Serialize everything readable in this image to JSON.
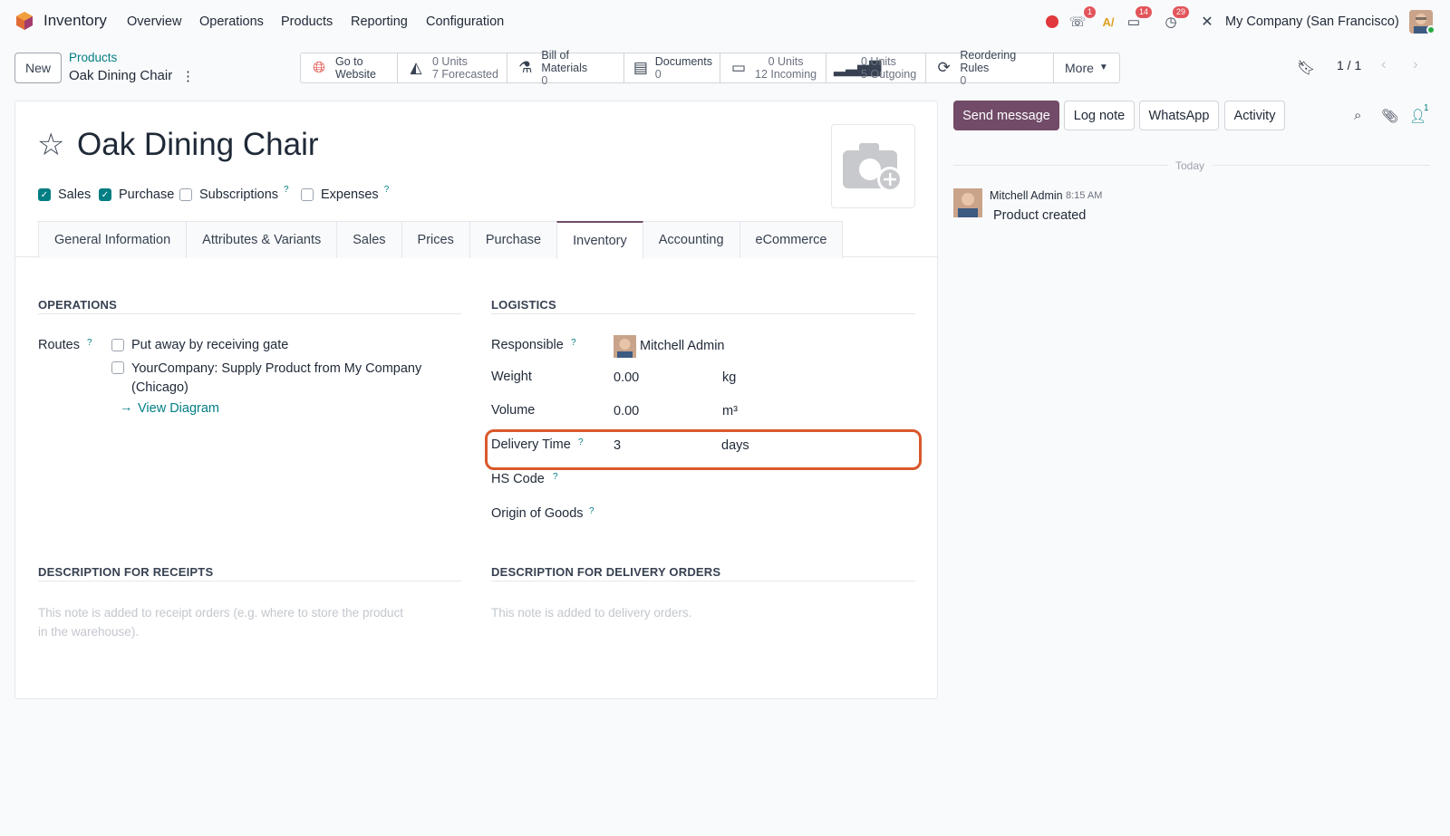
{
  "app": {
    "name": "Inventory"
  },
  "menu": [
    "Overview",
    "Operations",
    "Products",
    "Reporting",
    "Configuration"
  ],
  "systray": {
    "phone_badge": "1",
    "messages_badge": "14",
    "activity_badge": "29",
    "company": "My Company (San Francisco)"
  },
  "control": {
    "new_label": "New",
    "breadcrumb_parent": "Products",
    "breadcrumb_current": "Oak Dining Chair",
    "pager": "1 / 1"
  },
  "smart_buttons": {
    "website": {
      "line1": "Go to",
      "line2": "Website"
    },
    "forecast": {
      "line1": "0 Units",
      "line2": "7 Forecasted"
    },
    "bom": {
      "line1": "Bill of Materials",
      "line2": "0"
    },
    "documents": {
      "line1": "Documents",
      "line2": "0"
    },
    "incoming": {
      "line1": "0 Units",
      "line2": "12 Incoming"
    },
    "outgoing": {
      "line1": "0 Units",
      "line2": "5 Outgoing"
    },
    "reorder": {
      "line1": "Reordering Rules",
      "line2": "0"
    },
    "more": "More"
  },
  "product": {
    "name": "Oak Dining Chair",
    "flags": {
      "sales": "Sales",
      "purchase": "Purchase",
      "subscriptions": "Subscriptions",
      "expenses": "Expenses"
    }
  },
  "tabs": [
    "General Information",
    "Attributes & Variants",
    "Sales",
    "Prices",
    "Purchase",
    "Inventory",
    "Accounting",
    "eCommerce"
  ],
  "operations": {
    "title": "OPERATIONS",
    "routes_label": "Routes",
    "route1": "Put away by receiving gate",
    "route2_line1": "YourCompany: Supply Product from My Company",
    "route2_line2": "(Chicago)",
    "view_diagram": "View Diagram"
  },
  "logistics": {
    "title": "LOGISTICS",
    "responsible_label": "Responsible",
    "responsible": "Mitchell Admin",
    "weight_label": "Weight",
    "weight": "0.00",
    "weight_unit": "kg",
    "volume_label": "Volume",
    "volume": "0.00",
    "volume_unit": "m³",
    "delivery_label": "Delivery Time",
    "delivery": "3",
    "delivery_unit": "days",
    "hs_label": "HS Code",
    "origin_label": "Origin of Goods"
  },
  "descriptions": {
    "receipts_title": "DESCRIPTION FOR RECEIPTS",
    "receipts_ph1": "This note is added to receipt orders (e.g. where to store the product",
    "receipts_ph2": "in the warehouse).",
    "delivery_title": "DESCRIPTION FOR DELIVERY ORDERS",
    "delivery_ph": "This note is added to delivery orders."
  },
  "chatter": {
    "send": "Send message",
    "log": "Log note",
    "whatsapp": "WhatsApp",
    "activity": "Activity",
    "followers": "1",
    "today": "Today",
    "author": "Mitchell Admin",
    "time": "8:15 AM",
    "body": "Product created"
  },
  "colors": {
    "accent": "#714b67",
    "link": "#017e84",
    "highlight": "#d9582b"
  }
}
